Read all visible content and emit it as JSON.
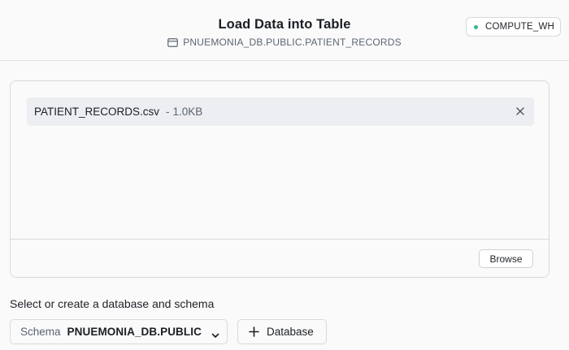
{
  "header": {
    "title": "Load Data into Table",
    "table_path": "PNUEMONIA_DB.PUBLIC.PATIENT_RECORDS",
    "table_icon": "table-icon",
    "warehouse": {
      "name": "COMPUTE_WH",
      "status_icon": "status-dot-icon",
      "status_color": "#3bb58e"
    }
  },
  "upload": {
    "file_name": "PATIENT_RECORDS.csv",
    "separator": "-",
    "file_size": "1.0KB",
    "remove_icon": "close-icon",
    "browse_label": "Browse"
  },
  "destination": {
    "section_label": "Select or create a database and schema",
    "schema_prefix": "Schema",
    "schema_value": "PNUEMONIA_DB.PUBLIC",
    "schema_icon": "chevron-down-icon",
    "add_database_label": "Database",
    "add_icon": "plus-icon"
  }
}
